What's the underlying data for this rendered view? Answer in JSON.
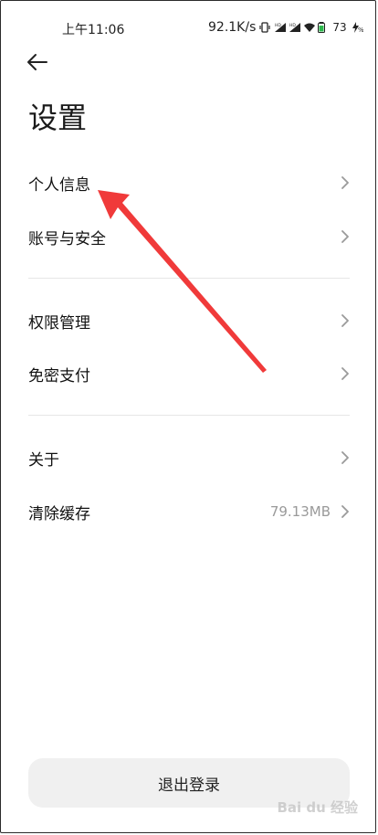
{
  "status_bar": {
    "time": "上午11:06",
    "net_speed": "92.1K/s",
    "battery": "73",
    "icons": [
      "vibrate-icon",
      "hd-signal-icon",
      "hd-signal-icon",
      "wifi-icon",
      "battery-icon",
      "charging-icon"
    ]
  },
  "header": {
    "back_icon": "arrow-left-icon",
    "title": "设置"
  },
  "groups": [
    {
      "items": [
        {
          "label": "个人信息",
          "value": ""
        },
        {
          "label": "账号与安全",
          "value": ""
        }
      ]
    },
    {
      "items": [
        {
          "label": "权限管理",
          "value": ""
        },
        {
          "label": "免密支付",
          "value": ""
        }
      ]
    },
    {
      "items": [
        {
          "label": "关于",
          "value": ""
        },
        {
          "label": "清除缓存",
          "value": "79.13MB"
        }
      ]
    }
  ],
  "logout_label": "退出登录",
  "annotation": {
    "color": "#f03a3a"
  },
  "watermark": "Bai du 经验"
}
